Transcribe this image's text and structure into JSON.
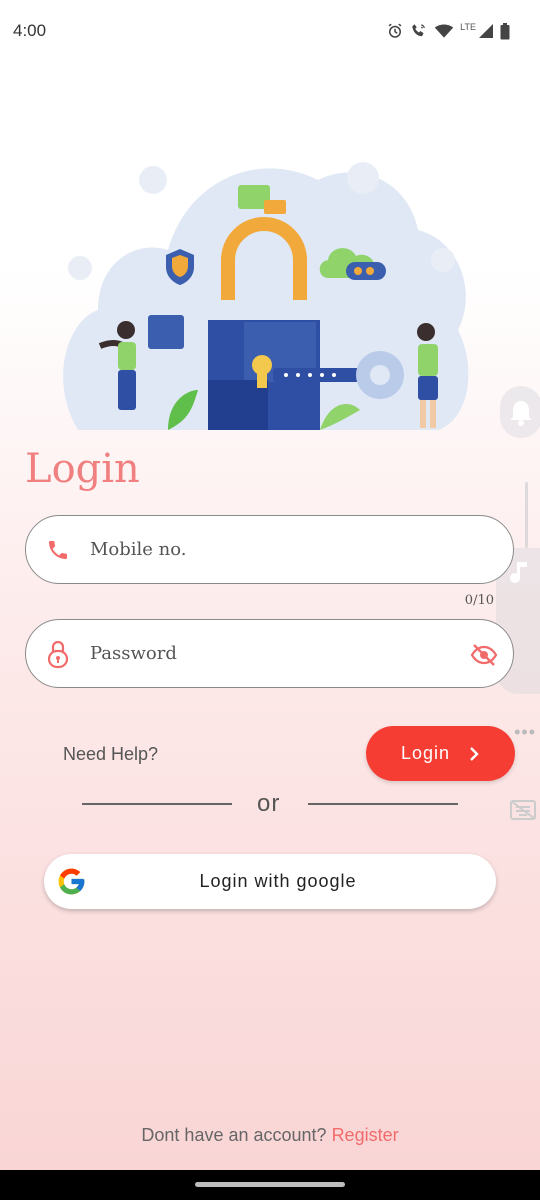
{
  "status_bar": {
    "time": "4:00",
    "network_label": "LTE",
    "icons": [
      "alarm-icon",
      "wifi-call-icon",
      "wifi-icon",
      "signal-icon",
      "battery-icon"
    ]
  },
  "title": "Login",
  "mobile_field": {
    "placeholder": "Mobile no.",
    "value": "",
    "counter": "0/10",
    "icon": "phone-icon"
  },
  "password_field": {
    "placeholder": "Password",
    "value": "",
    "icon": "lock-icon",
    "toggle_icon": "eye-off-icon"
  },
  "need_help": "Need Help?",
  "login_button": {
    "label": "Login",
    "icon": "chevron-right-icon"
  },
  "divider_text": "or",
  "google_button": {
    "label": "Login with google",
    "icon": "google-icon"
  },
  "register": {
    "prompt": "Dont have an account?",
    "link": "Register"
  },
  "colors": {
    "accent": "#f08080",
    "button": "#f53d33",
    "link": "#f26b6b"
  }
}
